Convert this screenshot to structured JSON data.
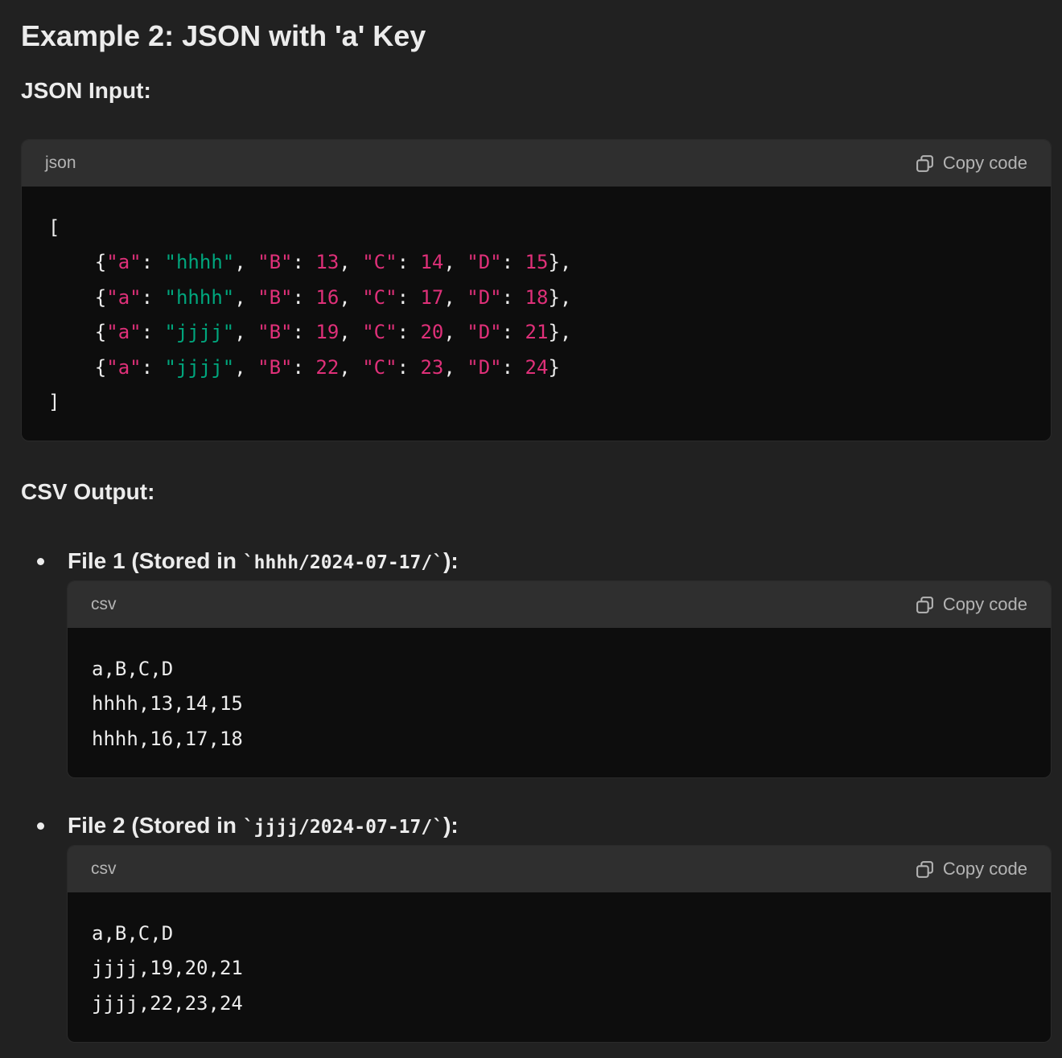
{
  "example_title": "Example 2: JSON with 'a' Key",
  "json_input_heading": "JSON Input:",
  "csv_output_heading": "CSV Output:",
  "json_block": {
    "language": "json",
    "copy_label": "Copy code",
    "open_bracket": "[",
    "close_bracket": "]",
    "rows": [
      {
        "a": "hhhh",
        "B": "13",
        "C": "14",
        "D": "15",
        "trail": "},"
      },
      {
        "a": "hhhh",
        "B": "16",
        "C": "17",
        "D": "18",
        "trail": "},"
      },
      {
        "a": "jjjj",
        "B": "19",
        "C": "20",
        "D": "21",
        "trail": "},"
      },
      {
        "a": "jjjj",
        "B": "22",
        "C": "23",
        "D": "24",
        "trail": "}"
      }
    ]
  },
  "files": [
    {
      "label_prefix": "File 1 (Stored in ",
      "path": "`hhhh/2024-07-17/`",
      "label_suffix": "):",
      "language": "csv",
      "copy_label": "Copy code",
      "lines": [
        "a,B,C,D",
        "hhhh,13,14,15",
        "hhhh,16,17,18"
      ]
    },
    {
      "label_prefix": "File 2 (Stored in ",
      "path": "`jjjj/2024-07-17/`",
      "label_suffix": "):",
      "language": "csv",
      "copy_label": "Copy code",
      "lines": [
        "a,B,C,D",
        "jjjj,19,20,21",
        "jjjj,22,23,24"
      ]
    }
  ],
  "icons": {
    "copy": "copy-icon"
  },
  "colors": {
    "background": "#212121",
    "code_background": "#0d0d0d",
    "code_header": "#2f2f2f",
    "string": "#00a67d",
    "key_number": "#df3079"
  }
}
